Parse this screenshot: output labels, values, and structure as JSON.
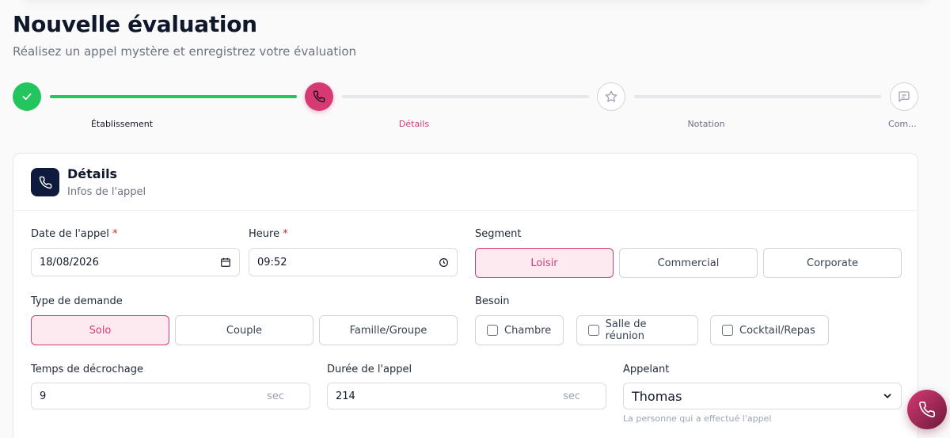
{
  "page": {
    "title": "Nouvelle évaluation",
    "subtitle": "Réalisez un appel mystère et enregistrez votre évaluation"
  },
  "stepper": {
    "steps": [
      {
        "label": "Établissement",
        "state": "done",
        "icon": "check-icon"
      },
      {
        "label": "Détails",
        "state": "active",
        "icon": "phone-icon"
      },
      {
        "label": "Notation",
        "state": "todo",
        "icon": "star-icon"
      },
      {
        "label": "Com...",
        "state": "todo",
        "icon": "comment-icon"
      }
    ]
  },
  "card": {
    "title": "Détails",
    "subtitle": "Infos de l'appel",
    "icon": "phone-icon"
  },
  "form": {
    "date": {
      "label": "Date de l'appel",
      "required_mark": "*",
      "value": "18/08/2026"
    },
    "time": {
      "label": "Heure",
      "required_mark": "*",
      "value": "09:52"
    },
    "segment": {
      "label": "Segment",
      "options": [
        "Loisir",
        "Commercial",
        "Corporate"
      ],
      "selected": "Loisir"
    },
    "request_type": {
      "label": "Type de demande",
      "options": [
        "Solo",
        "Couple",
        "Famille/Groupe"
      ],
      "selected": "Solo"
    },
    "need": {
      "label": "Besoin",
      "options": [
        "Chambre",
        "Salle de réunion",
        "Cocktail/Repas"
      ]
    },
    "pickup_time": {
      "label": "Temps de décrochage",
      "value": "9",
      "suffix": "sec"
    },
    "call_duration": {
      "label": "Durée de l'appel",
      "value": "214",
      "suffix": "sec"
    },
    "caller": {
      "label": "Appelant",
      "value": "Thomas",
      "help": "La personne qui a effectué l'appel"
    }
  },
  "colors": {
    "accent": "#d63a74",
    "success": "#22c55e",
    "dark": "#0f1b3d"
  }
}
